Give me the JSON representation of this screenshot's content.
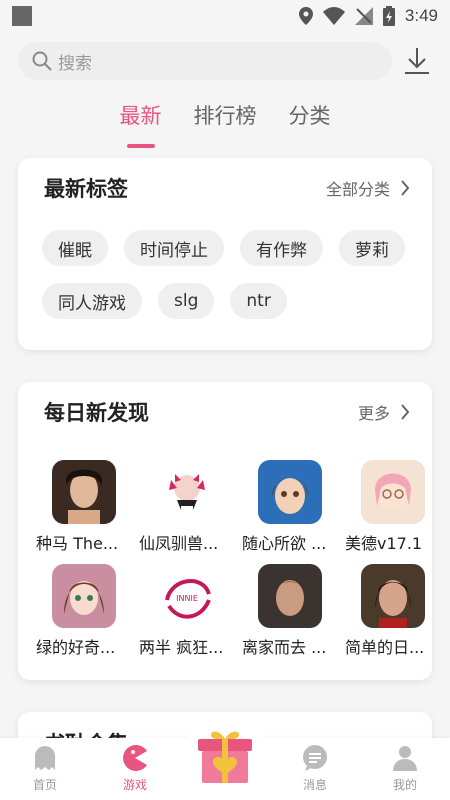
{
  "status": {
    "time": "3:49"
  },
  "search": {
    "placeholder": "搜索"
  },
  "tabs": [
    {
      "label": "最新",
      "active": true
    },
    {
      "label": "排行榜",
      "active": false
    },
    {
      "label": "分类",
      "active": false
    }
  ],
  "tags_card": {
    "title": "最新标签",
    "more": "全部分类",
    "tags": [
      "催眠",
      "时间停止",
      "有作弊",
      "萝莉",
      "同人游戏",
      "slg",
      "ntr"
    ]
  },
  "daily_card": {
    "title": "每日新发现",
    "more": "更多",
    "games": [
      {
        "name": "种马 The..."
      },
      {
        "name": "仙凤驯兽..."
      },
      {
        "name": "随心所欲 ..."
      },
      {
        "name": "美德v17.1"
      },
      {
        "name": "绿的好奇..."
      },
      {
        "name": "两半 疯狂..."
      },
      {
        "name": "离家而去 ..."
      },
      {
        "name": "简单的日..."
      }
    ]
  },
  "third_card": {
    "title": "书耻合集"
  },
  "bottom_nav": [
    {
      "label": "首页",
      "active": false
    },
    {
      "label": "游戏",
      "active": true
    },
    {
      "label": "消息",
      "active": false
    },
    {
      "label": "我的",
      "active": false
    }
  ],
  "colors": {
    "accent": "#e8557f",
    "background": "#f5f5f5",
    "tag_bg": "#efefef"
  }
}
